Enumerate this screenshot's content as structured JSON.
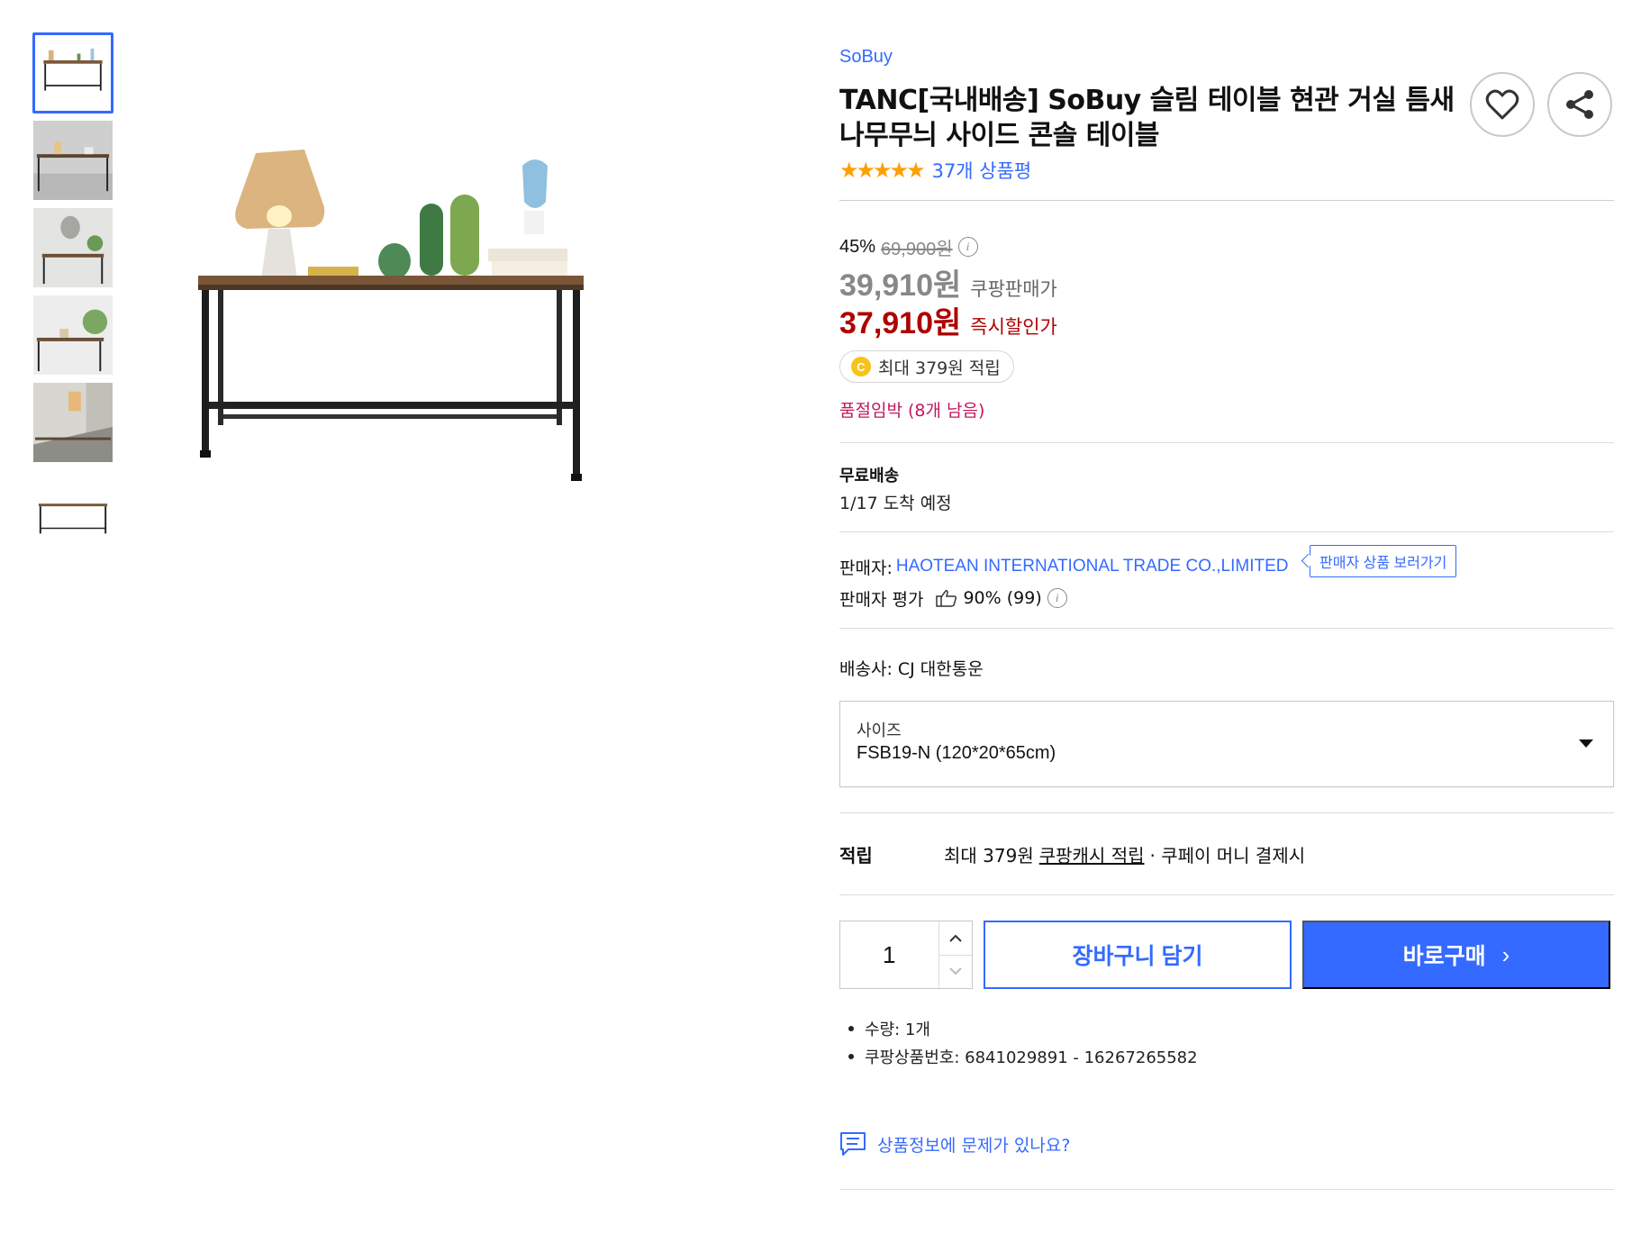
{
  "gallery": {
    "thumbnails": [
      "thumbnail-1",
      "thumbnail-2",
      "thumbnail-3",
      "thumbnail-4",
      "thumbnail-5",
      "thumbnail-6"
    ],
    "active_index": 0
  },
  "product": {
    "brand": "SoBuy",
    "title": "TANC[국내배송] SoBuy 슬림 테이블 현관 거실 틈새 나무무늬 사이드 콘솔 테이블",
    "rating_stars": 5,
    "review_count_text": "37개 상품평"
  },
  "price": {
    "discount_rate": "45%",
    "original_price": "69,900원",
    "seller_price": "39,910원",
    "seller_price_label": "쿠팡판매가",
    "instant_price": "37,910원",
    "instant_price_label": "즉시할인가",
    "reward_text": "최대 379원 적립",
    "coin_symbol": "C",
    "stock_notice": "품절임박 (8개 남음)"
  },
  "shipping": {
    "title": "무료배송",
    "eta": "1/17 도착 예정"
  },
  "seller": {
    "label": "판매자:",
    "name": "HAOTEAN INTERNATIONAL TRADE CO.,LIMITED",
    "products_button": "판매자 상품 보러가기",
    "rating_label": "판매자 평가",
    "rating_value": "90% (99)"
  },
  "carrier": {
    "text": "배송사: CJ 대한통운"
  },
  "option": {
    "label": "사이즈",
    "selected": "FSB19-N (120*20*65cm)"
  },
  "reward": {
    "key": "적립",
    "prefix": "최대 379원",
    "link": "쿠팡캐시 적립",
    "suffix": "· 쿠페이 머니 결제시"
  },
  "purchase": {
    "quantity": "1",
    "cart_label": "장바구니 담기",
    "buy_label": "바로구매"
  },
  "meta": {
    "quantity": "수량: 1개",
    "product_number": "쿠팡상품번호: 6841029891 - 16267265582"
  },
  "report": {
    "text": "상품정보에 문제가 있나요?"
  },
  "colors": {
    "accent": "#346aff",
    "instant_price": "#ae0000",
    "stock_notice": "#c2185b",
    "star": "#ff9f00"
  }
}
